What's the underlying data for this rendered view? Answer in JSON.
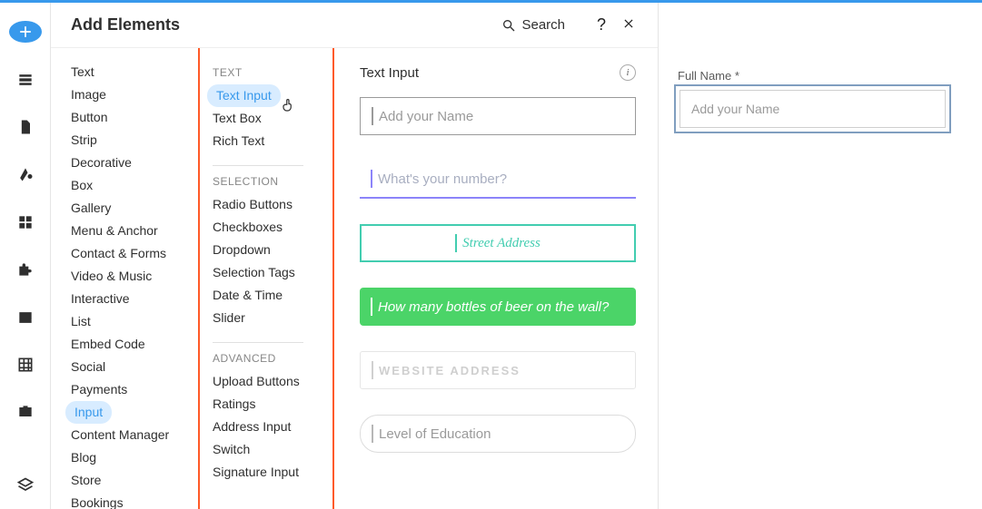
{
  "panel": {
    "title": "Add Elements",
    "searchLabel": "Search"
  },
  "categories": [
    "Text",
    "Image",
    "Button",
    "Strip",
    "Decorative",
    "Box",
    "Gallery",
    "Menu & Anchor",
    "Contact & Forms",
    "Video & Music",
    "Interactive",
    "List",
    "Embed Code",
    "Social",
    "Payments",
    "Input",
    "Content Manager",
    "Blog",
    "Store",
    "Bookings"
  ],
  "activeCategory": "Input",
  "subGroups": [
    {
      "title": "TEXT",
      "items": [
        "Text Input",
        "Text Box",
        "Rich Text"
      ]
    },
    {
      "title": "SELECTION",
      "items": [
        "Radio Buttons",
        "Checkboxes",
        "Dropdown",
        "Selection Tags",
        "Date & Time",
        "Slider"
      ]
    },
    {
      "title": "ADVANCED",
      "items": [
        "Upload Buttons",
        "Ratings",
        "Address Input",
        "Switch",
        "Signature Input"
      ]
    }
  ],
  "activeSubItem": "Text Input",
  "previewHeading": "Text Input",
  "previews": {
    "p1": {
      "placeholder": "Add your Name"
    },
    "p2": {
      "placeholder": "What's your number?"
    },
    "p3": {
      "placeholder": "Street Address"
    },
    "p4": {
      "placeholder": "How many bottles of beer on the wall?"
    },
    "p5": {
      "placeholder": "WEBSITE ADDRESS"
    },
    "p6": {
      "placeholder": "Level of Education"
    }
  },
  "canvas": {
    "label": "Full Name *",
    "placeholder": "Add your Name"
  }
}
